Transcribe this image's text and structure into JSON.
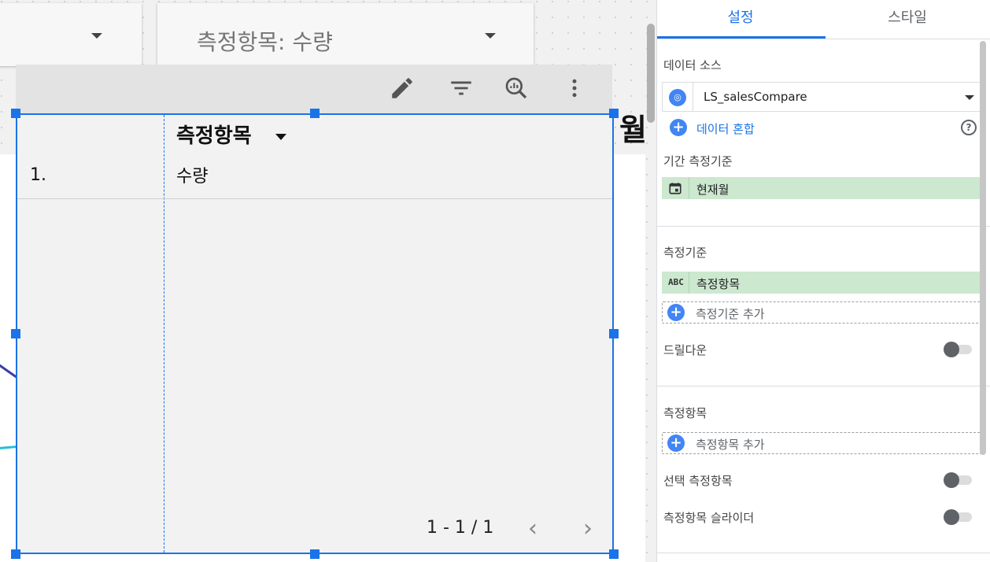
{
  "canvas": {
    "controls": [
      {
        "label": ""
      },
      {
        "label": "측정항목: 수량"
      }
    ],
    "chart_title": "월",
    "table": {
      "header": "측정항목",
      "rows": [
        {
          "index": "1.",
          "value": "수량"
        }
      ],
      "pagination": "1 - 1 / 1"
    }
  },
  "panel": {
    "tabs": [
      {
        "label": "설정"
      },
      {
        "label": "스타일"
      }
    ],
    "data_source": {
      "section_label": "데이터 소스",
      "name": "LS_salesCompare",
      "blend_link": "데이터 혼합"
    },
    "date_range": {
      "section_label": "기간 측정기준",
      "value": "현재월"
    },
    "dimension": {
      "section_label": "측정기준",
      "value": "측정항목",
      "type_badge": "ABC",
      "add_label": "측정기준 추가",
      "drilldown_label": "드릴다운"
    },
    "metric": {
      "section_label": "측정항목",
      "add_label": "측정항목 추가",
      "optional_metrics_label": "선택 측정항목",
      "metric_slider_label": "측정항목 슬라이더"
    }
  }
}
